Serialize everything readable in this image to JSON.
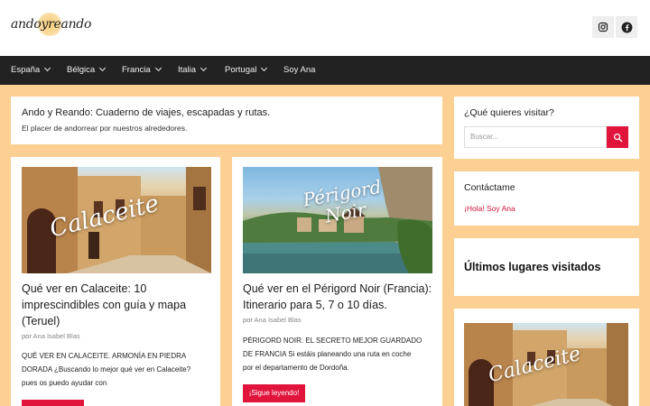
{
  "header": {
    "logo_text": "andoyreando",
    "social": [
      {
        "name": "instagram",
        "icon": "instagram-icon"
      },
      {
        "name": "facebook",
        "icon": "facebook-icon"
      }
    ]
  },
  "nav": {
    "items": [
      {
        "label": "España",
        "has_dropdown": true
      },
      {
        "label": "Bélgica",
        "has_dropdown": true
      },
      {
        "label": "Francia",
        "has_dropdown": true
      },
      {
        "label": "Italia",
        "has_dropdown": true
      },
      {
        "label": "Portugal",
        "has_dropdown": true
      },
      {
        "label": "Soy Ana",
        "has_dropdown": false
      }
    ]
  },
  "site": {
    "title": "Ando y Reando: Cuaderno de viajes, escapadas y rutas.",
    "description": "El placer de andorrear por nuestros alrededores."
  },
  "posts": [
    {
      "image_text": "Calaceite",
      "title_lines": [
        "Qué ver en Calaceite: 10",
        "imprescindibles con guía y mapa",
        "(Teruel)"
      ],
      "byline_prefix": "por",
      "author": "Ana Isabel Blas",
      "excerpt_lines": [
        "QUÉ VER EN CALACEITE. ARMONÍA EN PIEDRA",
        "DORADA ¿Buscando lo mejor qué ver en Calaceite?",
        "pues os puedo ayudar con"
      ],
      "button_label": ""
    },
    {
      "image_text_lines": [
        "Périgord",
        "Noir"
      ],
      "title_lines": [
        "Qué ver en el Périgord Noir (Francia):",
        "Itinerario para 5, 7 o 10 días."
      ],
      "byline_prefix": "por",
      "author": "Ana Isabel Blas",
      "excerpt_lines": [
        "PÉRIGORD NOIR. EL SECRETO MEJOR GUARDADO",
        "DE FRANCIA Si estáis planeando una ruta en coche",
        "por el departamento de Dordoña."
      ],
      "button_label": "¡Sigue leyendo!"
    }
  ],
  "sidebar": {
    "search": {
      "title": "¿Qué quieres visitar?",
      "placeholder": "Buscar..."
    },
    "contact": {
      "title": "Contáctame",
      "link": "¡Hola! Soy Ana"
    },
    "recent": {
      "title": "Últimos lugares visitados",
      "image_text": "Calaceite"
    }
  },
  "colors": {
    "accent": "#e1143c",
    "background": "#fccf92",
    "nav": "#222222"
  }
}
